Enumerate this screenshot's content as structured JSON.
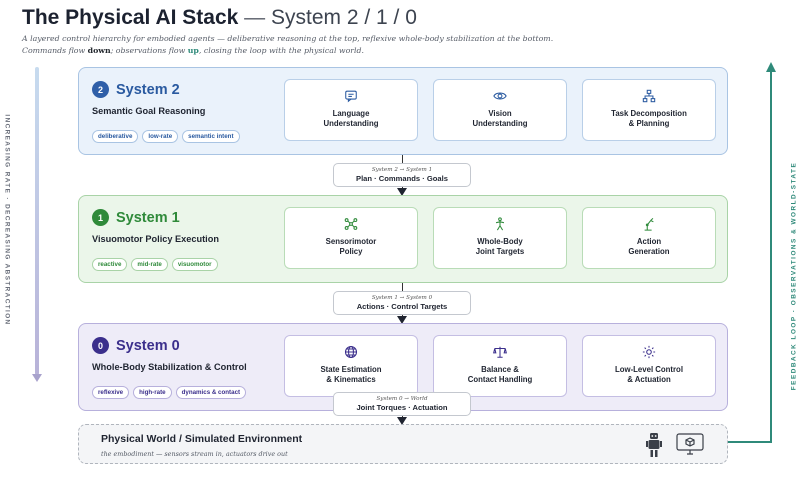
{
  "header": {
    "title_bold": "The Physical AI Stack",
    "title_dash": " — ",
    "title_sub": "System 2 / 1 / 0",
    "desc_line1": "A layered control hierarchy for embodied agents — deliberative reasoning at the top, reflexive whole-body stabilization at the bottom.",
    "desc_line2_a": "Commands flow ",
    "desc_line2_down": "down",
    "desc_line2_b": "; observations flow ",
    "desc_line2_up": "up",
    "desc_line2_c": ", closing the loop with the physical world."
  },
  "side_labels": {
    "left": "INCREASING RATE · DECREASING ABSTRACTION",
    "right": "FEEDBACK LOOP · OBSERVATIONS & WORLD-STATE"
  },
  "layers": [
    {
      "badge": "2",
      "name": "System 2",
      "subtitle": "Semantic Goal Reasoning",
      "tags": [
        "deliberative",
        "low-rate",
        "semantic intent"
      ],
      "accent": "#2a5aa0",
      "cards": [
        {
          "icon": "chat-icon",
          "title": "Language\nUnderstanding"
        },
        {
          "icon": "eye-icon",
          "title": "Vision\nUnderstanding"
        },
        {
          "icon": "hierarchy-icon",
          "title": "Task Decomposition\n& Planning"
        }
      ]
    },
    {
      "badge": "1",
      "name": "System 1",
      "subtitle": "Visuomotor Policy Execution",
      "tags": [
        "reactive",
        "mid-rate",
        "visuomotor"
      ],
      "accent": "#2f8a3a",
      "cards": [
        {
          "icon": "network-icon",
          "title": "Sensorimotor\nPolicy"
        },
        {
          "icon": "person-icon",
          "title": "Whole-Body\nJoint Targets"
        },
        {
          "icon": "robot-arm-icon",
          "title": "Action\nGeneration"
        }
      ]
    },
    {
      "badge": "0",
      "name": "System 0",
      "subtitle": "Whole-Body Stabilization & Control",
      "tags": [
        "reflexive",
        "high-rate",
        "dynamics & contact"
      ],
      "accent": "#3b2f8c",
      "cards": [
        {
          "icon": "globe-icon",
          "title": "State Estimation\n& Kinematics"
        },
        {
          "icon": "balance-icon",
          "title": "Balance &\nContact Handling"
        },
        {
          "icon": "sun-icon",
          "title": "Low-Level Control\n& Actuation"
        }
      ]
    }
  ],
  "connectors": [
    {
      "route": "System 2 → System 1",
      "label": "Plan · Commands · Goals"
    },
    {
      "route": "System 1 → System 0",
      "label": "Actions · Control Targets"
    },
    {
      "route": "System 0 → World",
      "label": "Joint Torques · Actuation"
    }
  ],
  "world": {
    "title": "Physical World / Simulated Environment",
    "subtitle": "the embodiment — sensors stream in, actuators drive out",
    "icons": [
      "robot-icon",
      "monitor-icon"
    ]
  }
}
